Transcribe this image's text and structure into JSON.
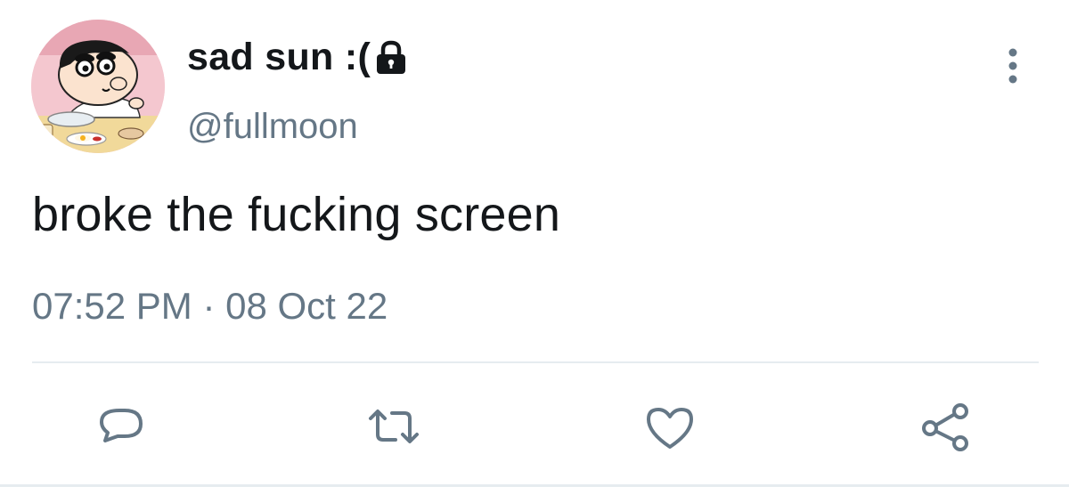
{
  "user": {
    "display_name": "sad sun :(",
    "handle": "@fullmoon",
    "avatar_icon": "cartoon-avatar-icon",
    "protected_icon": "lock-icon"
  },
  "tweet": {
    "text": "broke the fucking screen",
    "timestamp": "07:52 PM · 08 Oct 22"
  },
  "actions": {
    "more_icon": "more-vertical-icon",
    "reply_icon": "reply-icon",
    "retweet_icon": "retweet-icon",
    "like_icon": "like-heart-icon",
    "share_icon": "share-icon"
  },
  "colors": {
    "text_primary": "#14171a",
    "text_secondary": "#657786",
    "divider": "#e6ecf0"
  }
}
